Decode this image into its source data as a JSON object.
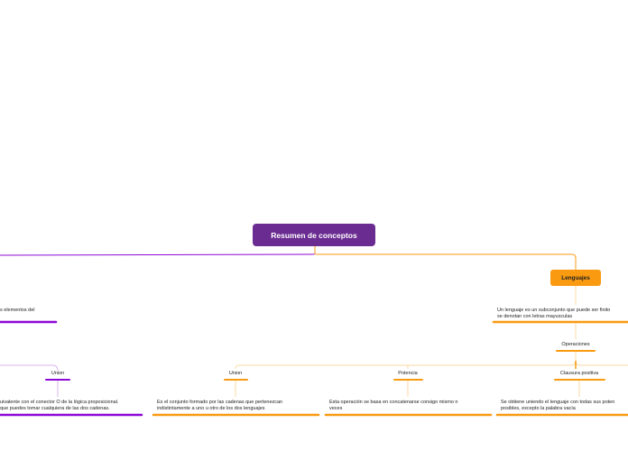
{
  "colors": {
    "purple": "#6a2c91",
    "purple_bright": "#8e08d8",
    "purple_light": "#d9b4ee",
    "orange": "#f99a11",
    "orange_light": "#fbd9a3",
    "text": "#222222"
  },
  "root": {
    "label": "Resumen de conceptos"
  },
  "left_branch": {
    "fragment": "s elementos del",
    "union_label": "Union",
    "union_desc": "uivalente con el conector O de la lógica proposicional.\nque puedes tomar cualquiera de las dos cadenas."
  },
  "lenguajes": {
    "label": "Lenguajes",
    "desc": "Un lenguaje es un subconjunto que puede ser finito\nse denotan con letras mayusculas",
    "operaciones_label": "Operaciones",
    "ops": [
      {
        "label": "Union",
        "desc": "Es el conjunto formado por las cadenas que pertenezcan\nindistintamente a uno u otro de los dos lenguajes"
      },
      {
        "label": "Potencia",
        "desc": "Esta operación se basa en concatenarse consigo mismo n\nveces"
      },
      {
        "label": "Clausura positiva",
        "desc": "Se obtiene uniendo el lenguaje con todas sus poten\nposibles, excepto la palabra vacía"
      }
    ]
  }
}
